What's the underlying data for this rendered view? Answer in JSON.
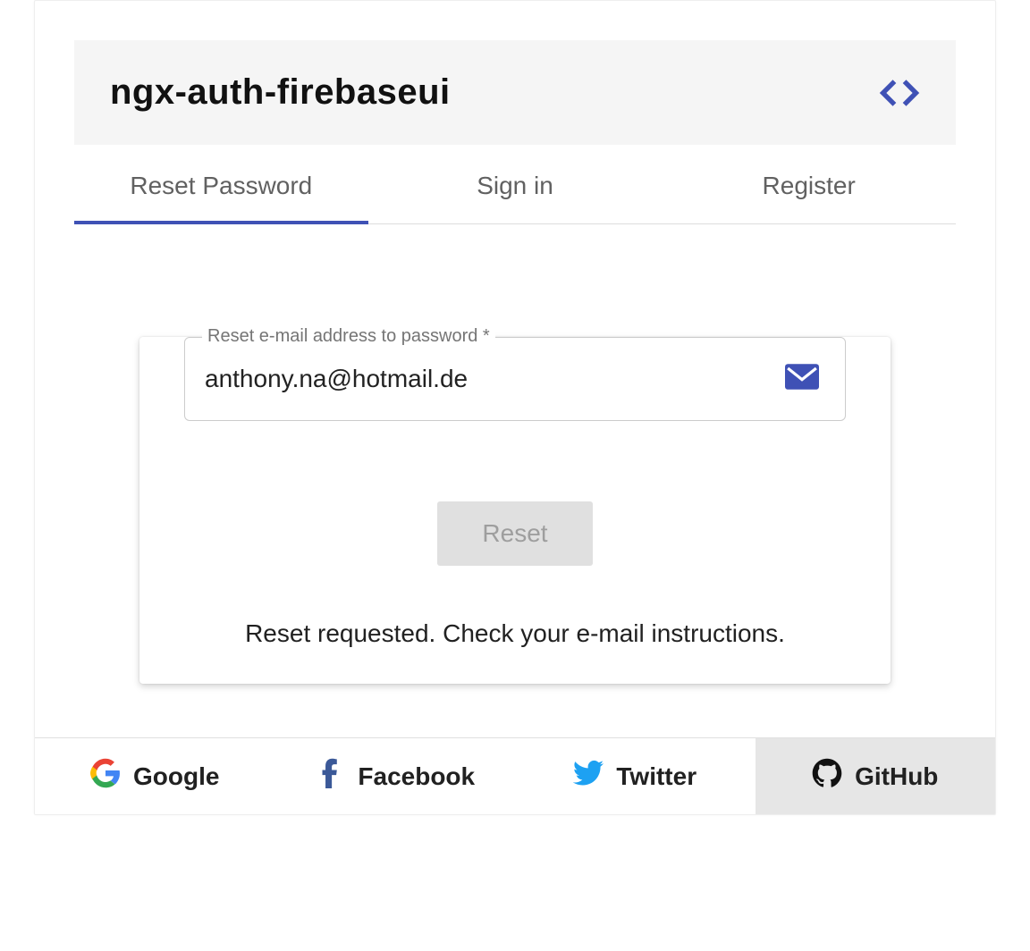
{
  "header": {
    "title": "ngx-auth-firebaseui"
  },
  "tabs": [
    {
      "label": "Reset Password",
      "active": true
    },
    {
      "label": "Sign in",
      "active": false
    },
    {
      "label": "Register",
      "active": false
    }
  ],
  "reset": {
    "field_label": "Reset e-mail address to password *",
    "email": "anthony.na@hotmail.de",
    "button": "Reset",
    "status": "Reset requested. Check your e-mail instructions."
  },
  "providers": [
    {
      "name": "Google"
    },
    {
      "name": "Facebook"
    },
    {
      "name": "Twitter"
    },
    {
      "name": "GitHub",
      "selected": true
    }
  ],
  "colors": {
    "accent": "#3f51b5"
  }
}
